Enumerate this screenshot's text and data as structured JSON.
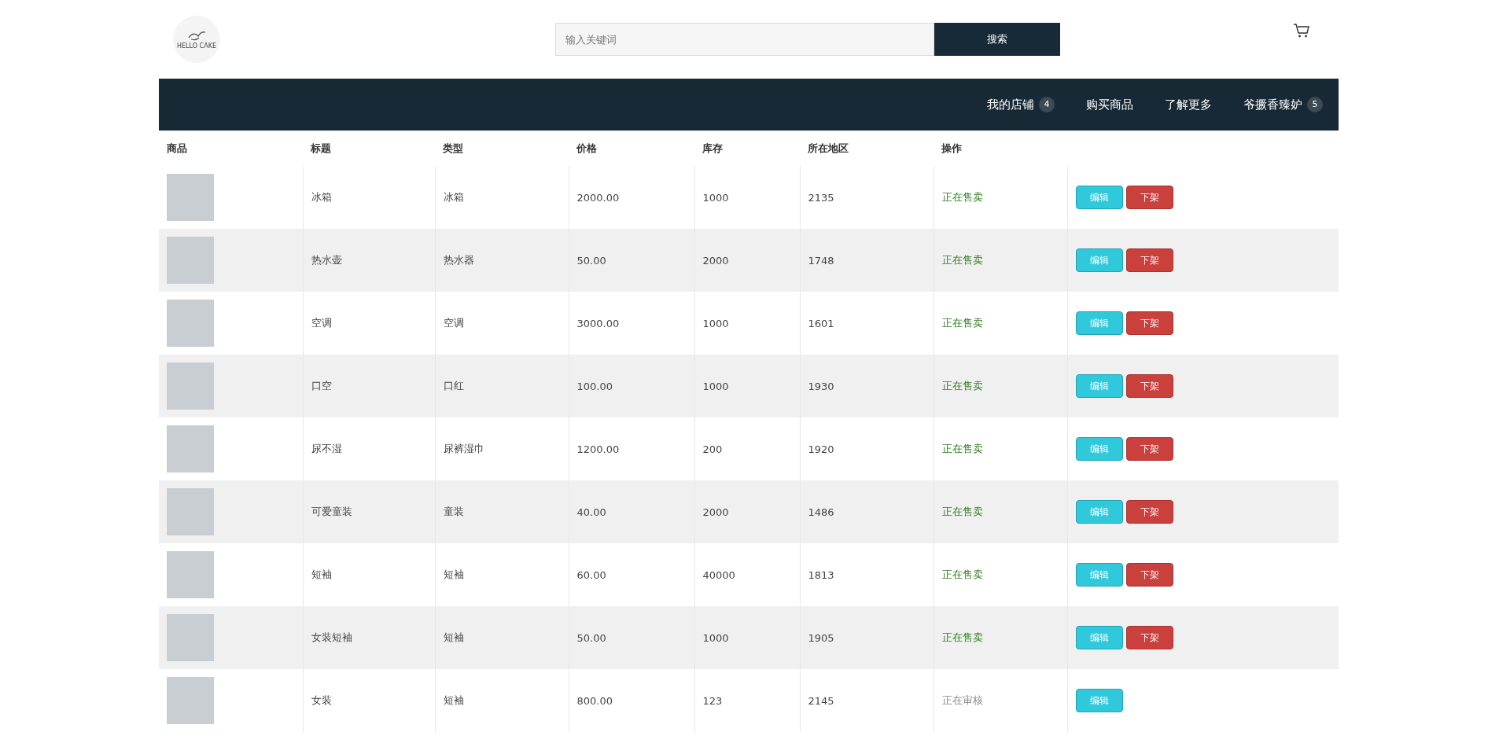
{
  "header": {
    "logo_text": "HELLO CAKE",
    "search": {
      "placeholder": "输入关键词",
      "button": "搜索"
    }
  },
  "nav": {
    "items": [
      {
        "label": "我的店铺",
        "badge": "4"
      },
      {
        "label": "购买商品"
      },
      {
        "label": "了解更多"
      },
      {
        "label": "爷撅香臻妒",
        "badge": "5"
      }
    ]
  },
  "table": {
    "columns": [
      "商品",
      "标题",
      "类型",
      "价格",
      "库存",
      "所在地区",
      "操作"
    ],
    "rows": [
      {
        "title": "冰箱",
        "type": "冰箱",
        "price": "2000.00",
        "stock": "1000",
        "region": "2135",
        "status": {
          "text": "正在售卖",
          "kind": "selling"
        },
        "actions": [
          {
            "label": "编辑",
            "kind": "edit"
          },
          {
            "label": "下架",
            "kind": "remove"
          }
        ]
      },
      {
        "title": "热水壶",
        "type": "热水器",
        "price": "50.00",
        "stock": "2000",
        "region": "1748",
        "status": {
          "text": "正在售卖",
          "kind": "selling"
        },
        "actions": [
          {
            "label": "编辑",
            "kind": "edit"
          },
          {
            "label": "下架",
            "kind": "remove"
          }
        ]
      },
      {
        "title": "空调",
        "type": "空调",
        "price": "3000.00",
        "stock": "1000",
        "region": "1601",
        "status": {
          "text": "正在售卖",
          "kind": "selling"
        },
        "actions": [
          {
            "label": "编辑",
            "kind": "edit"
          },
          {
            "label": "下架",
            "kind": "remove"
          }
        ]
      },
      {
        "title": "口空",
        "type": "口红",
        "price": "100.00",
        "stock": "1000",
        "region": "1930",
        "status": {
          "text": "正在售卖",
          "kind": "selling"
        },
        "actions": [
          {
            "label": "编辑",
            "kind": "edit"
          },
          {
            "label": "下架",
            "kind": "remove"
          }
        ]
      },
      {
        "title": "尿不湿",
        "type": "尿裤湿巾",
        "price": "1200.00",
        "stock": "200",
        "region": "1920",
        "status": {
          "text": "正在售卖",
          "kind": "selling"
        },
        "actions": [
          {
            "label": "编辑",
            "kind": "edit"
          },
          {
            "label": "下架",
            "kind": "remove"
          }
        ]
      },
      {
        "title": "可爱童装",
        "type": "童装",
        "price": "40.00",
        "stock": "2000",
        "region": "1486",
        "status": {
          "text": "正在售卖",
          "kind": "selling"
        },
        "actions": [
          {
            "label": "编辑",
            "kind": "edit"
          },
          {
            "label": "下架",
            "kind": "remove"
          }
        ]
      },
      {
        "title": "短袖",
        "type": "短袖",
        "price": "60.00",
        "stock": "40000",
        "region": "1813",
        "status": {
          "text": "正在售卖",
          "kind": "selling"
        },
        "actions": [
          {
            "label": "编辑",
            "kind": "edit"
          },
          {
            "label": "下架",
            "kind": "remove"
          }
        ]
      },
      {
        "title": "女装短袖",
        "type": "短袖",
        "price": "50.00",
        "stock": "1000",
        "region": "1905",
        "status": {
          "text": "正在售卖",
          "kind": "selling"
        },
        "actions": [
          {
            "label": "编辑",
            "kind": "edit"
          },
          {
            "label": "下架",
            "kind": "remove"
          }
        ]
      },
      {
        "title": "女装",
        "type": "短袖",
        "price": "800.00",
        "stock": "123",
        "region": "2145",
        "status": {
          "text": "正在审核",
          "kind": "review"
        },
        "actions": [
          {
            "label": "编辑",
            "kind": "edit"
          }
        ]
      }
    ]
  }
}
